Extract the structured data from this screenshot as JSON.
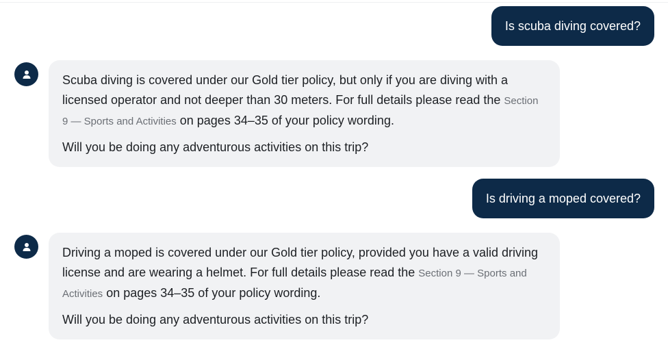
{
  "messages": [
    {
      "role": "user",
      "text": "Is scuba diving covered?"
    },
    {
      "role": "assistant",
      "text_before_link": "Scuba diving is covered under our Gold tier policy, but only if you are diving with a licensed operator and not deeper than 30 meters. For full details please read the ",
      "link_text": "Section 9 — Sports and Activities",
      "text_after_link": " on pages 34–35 of your policy wording.",
      "followup": "Will you be doing any adventurous activities on this trip?"
    },
    {
      "role": "user",
      "text": "Is driving a moped covered?"
    },
    {
      "role": "assistant",
      "text_before_link": "Driving a moped is covered under our Gold tier policy, provided you have a valid driving license and are wearing a helmet. For full details please read the ",
      "link_text": "Section 9 — Sports and Activities",
      "text_after_link": " on pages 34–35 of your policy wording.",
      "followup": "Will you be doing any adventurous activities on this trip?"
    }
  ],
  "icons": {
    "assistant_avatar": "user-icon"
  },
  "colors": {
    "user_bubble": "#0d2a48",
    "assistant_bubble": "#f1f2f4",
    "avatar": "#0d2a48",
    "link_text": "#6b6f75"
  }
}
